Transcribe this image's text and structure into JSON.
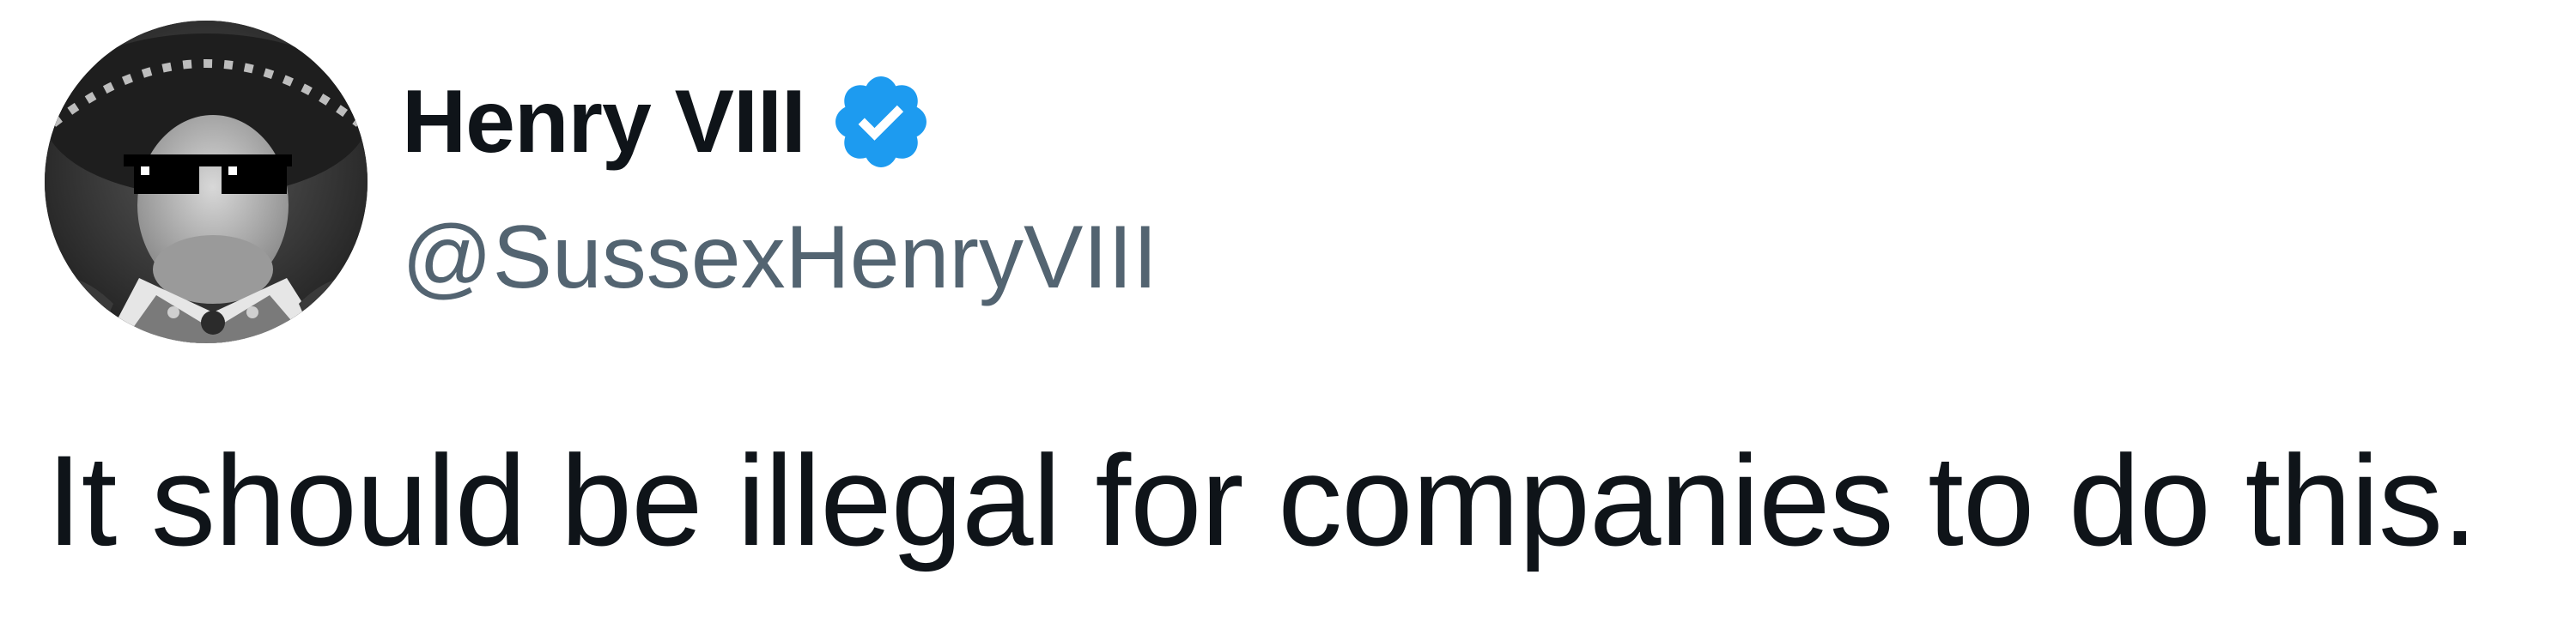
{
  "tweet": {
    "author": {
      "display_name": "Henry VIII",
      "handle": "@SussexHenryVIII",
      "verified": true,
      "verified_icon": "verified-badge-icon",
      "avatar": "avatar-portrait"
    },
    "text": "It should be illegal for companies to do this."
  },
  "colors": {
    "name": "#0f1419",
    "handle": "#536471",
    "verified": "#1d9bf0",
    "text": "#0f1419",
    "background": "#ffffff"
  }
}
